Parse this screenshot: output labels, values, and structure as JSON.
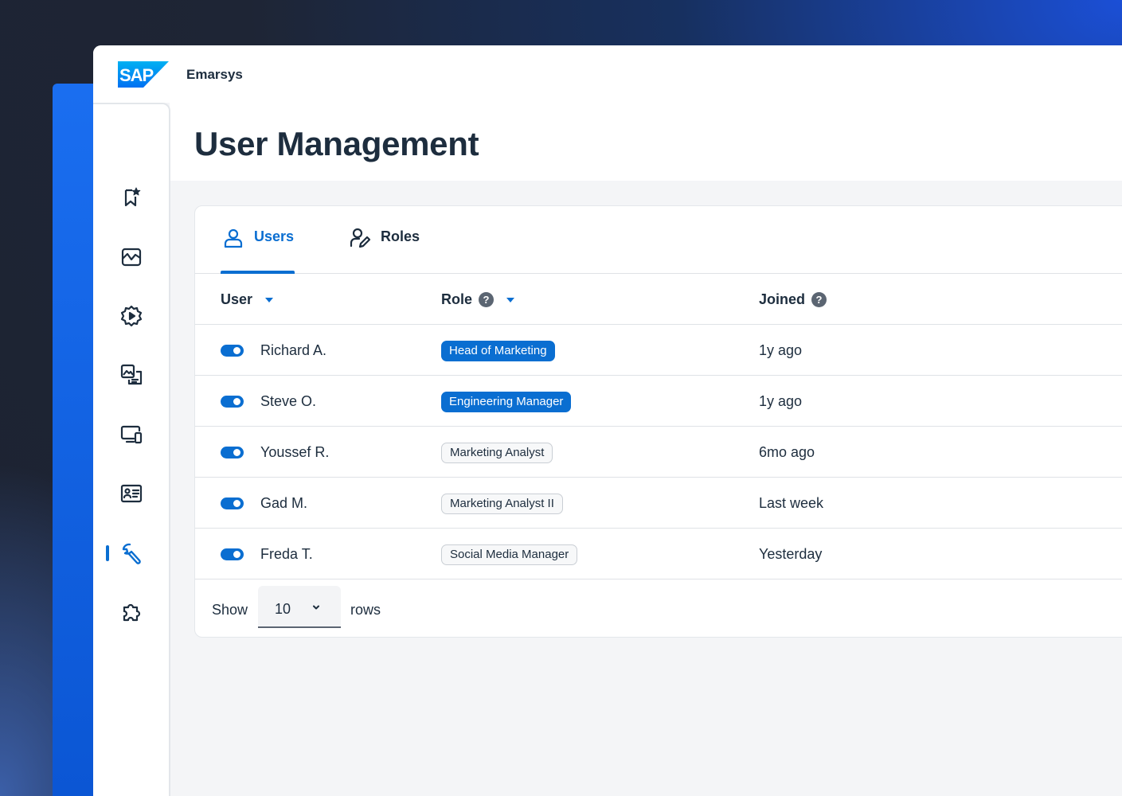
{
  "app": {
    "brand_logo": "SAP",
    "name": "Emarsys",
    "accent_color": "#0a6ed1"
  },
  "page": {
    "title": "User Management"
  },
  "sidebar": {
    "items": [
      {
        "icon": "bookmark-star-icon",
        "active": false
      },
      {
        "icon": "analytics-chart-icon",
        "active": false
      },
      {
        "icon": "automation-gear-icon",
        "active": false
      },
      {
        "icon": "content-media-icon",
        "active": false
      },
      {
        "icon": "devices-icon",
        "active": false
      },
      {
        "icon": "contact-card-icon",
        "active": false
      },
      {
        "icon": "wrench-icon",
        "active": true
      },
      {
        "icon": "puzzle-piece-icon",
        "active": false
      }
    ]
  },
  "tabs": [
    {
      "label": "Users",
      "icon": "users-icon",
      "active": true
    },
    {
      "label": "Roles",
      "icon": "user-edit-icon",
      "active": false
    }
  ],
  "table": {
    "columns": {
      "user": "User",
      "role": "Role",
      "joined": "Joined"
    },
    "rows": [
      {
        "user": "Richard A.",
        "role": "Head of Marketing",
        "role_style": "primary",
        "joined": "1y ago",
        "enabled": true
      },
      {
        "user": "Steve O.",
        "role": "Engineering Manager",
        "role_style": "primary",
        "joined": "1y ago",
        "enabled": true
      },
      {
        "user": "Youssef R.",
        "role": "Marketing Analyst",
        "role_style": "secondary",
        "joined": "6mo ago",
        "enabled": true
      },
      {
        "user": "Gad M.",
        "role": "Marketing Analyst II",
        "role_style": "secondary",
        "joined": "Last week",
        "enabled": true
      },
      {
        "user": "Freda T.",
        "role": "Social Media Manager",
        "role_style": "secondary",
        "joined": "Yesterday",
        "enabled": true
      }
    ]
  },
  "pagination": {
    "show_label": "Show",
    "rows_value": "10",
    "rows_label": "rows"
  }
}
